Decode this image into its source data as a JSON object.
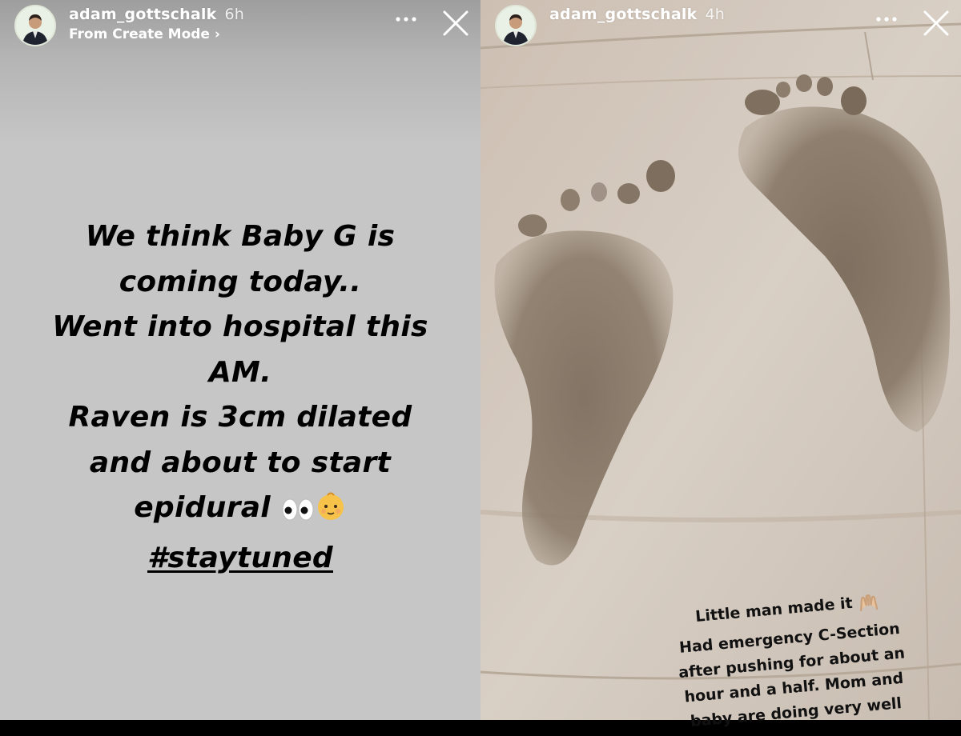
{
  "stories": [
    {
      "username": "adam_gottschalk",
      "time": "6h",
      "subtitle": "From Create Mode ›",
      "text_lines": [
        "We think Baby G is",
        "coming today..",
        "Went into hospital this",
        "AM.",
        "Raven is 3cm dilated",
        "and about to start",
        "epidural"
      ],
      "hashtag": "#staytuned",
      "emoji_icons": [
        "eyes-emoji-icon",
        "baby-emoji-icon"
      ]
    },
    {
      "username": "adam_gottschalk",
      "time": "4h",
      "caption_lines": [
        "Little man made it",
        "Had emergency C-Section",
        "after pushing for about an",
        "hour and a half. Mom and",
        "baby are doing very well"
      ],
      "caption_icon": "raised-hands-icon"
    }
  ],
  "icons": {
    "more": "more-dots-icon",
    "close": "close-icon",
    "avatar": "avatar"
  },
  "colors": {
    "left_bg": "#c6c6c6",
    "right_bg": "#cfc6bc",
    "ink": "#000000",
    "header_text": "#ffffff"
  }
}
